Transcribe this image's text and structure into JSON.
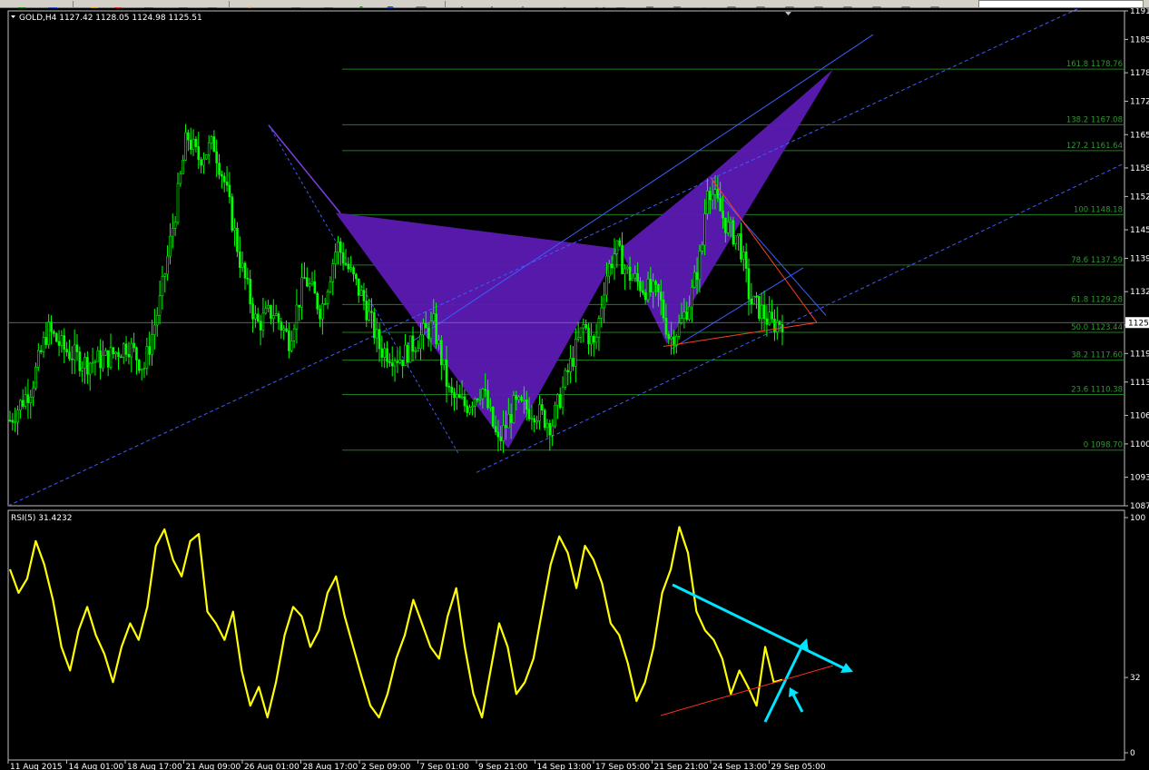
{
  "toolbar": {
    "buttons": [
      "new-order-icon",
      "open-icon",
      "zoom-in-icon",
      "zoom-out-icon",
      "tile-icon",
      "scroll-icon",
      "autoscroll-icon",
      "crosshair-icon",
      "line-icon",
      "indicator-icon",
      "period-icon",
      "template-icon"
    ]
  },
  "main_chart": {
    "title": "GOLD,H4  1127.42  1128.05  1124.98  1125.51",
    "current_price": "1125",
    "colors": {
      "background": "#000000",
      "candle": "#00ff00",
      "fib_line": "#1e7d1e",
      "fib_text": "#2e9a2e",
      "pattern_fill": "#5b1ab3",
      "channel": "#3d5cff",
      "triangle": "#ff4020"
    }
  },
  "rsi_panel": {
    "title": "RSI(5) 31.4232",
    "line_color": "#ffff00",
    "arrow_color": "#00e5ff"
  },
  "chart_data": [
    {
      "type": "candlestick",
      "symbol": "GOLD",
      "timeframe": "H4",
      "ylim": [
        1087,
        1191
      ],
      "y_ticks": [
        1191,
        1185,
        1178,
        1172,
        1165,
        1158,
        1152,
        1145,
        1139,
        1132,
        1125,
        1119,
        1113,
        1106,
        1100,
        1093,
        1087
      ],
      "fib_levels": [
        {
          "label": "161.8 1178.76",
          "value": 1178.76
        },
        {
          "label": "138.2 1167.08",
          "value": 1167.08
        },
        {
          "label": "127.2 1161.64",
          "value": 1161.64
        },
        {
          "label": "100 1148.18",
          "value": 1148.18
        },
        {
          "label": "78.6 1137.59",
          "value": 1137.59
        },
        {
          "label": "61.8 1129.28",
          "value": 1129.28
        },
        {
          "label": "50.0 1123.44",
          "value": 1123.44
        },
        {
          "label": "38.2 1117.60",
          "value": 1117.6
        },
        {
          "label": "23.6 1110.38",
          "value": 1110.38
        },
        {
          "label": "0 1098.70",
          "value": 1098.7
        }
      ],
      "close_path": [
        [
          0,
          1105
        ],
        [
          0.02,
          1112
        ],
        [
          0.035,
          1124
        ],
        [
          0.05,
          1120
        ],
        [
          0.07,
          1117
        ],
        [
          0.09,
          1118
        ],
        [
          0.11,
          1121
        ],
        [
          0.125,
          1116
        ],
        [
          0.14,
          1130
        ],
        [
          0.155,
          1150
        ],
        [
          0.165,
          1165
        ],
        [
          0.175,
          1160
        ],
        [
          0.19,
          1163
        ],
        [
          0.2,
          1155
        ],
        [
          0.215,
          1138
        ],
        [
          0.23,
          1125
        ],
        [
          0.245,
          1128
        ],
        [
          0.26,
          1122
        ],
        [
          0.275,
          1135
        ],
        [
          0.29,
          1128
        ],
        [
          0.305,
          1142
        ],
        [
          0.315,
          1137
        ],
        [
          0.33,
          1130
        ],
        [
          0.345,
          1120
        ],
        [
          0.365,
          1118
        ],
        [
          0.38,
          1122
        ],
        [
          0.395,
          1125
        ],
        [
          0.41,
          1110
        ],
        [
          0.425,
          1108
        ],
        [
          0.44,
          1112
        ],
        [
          0.455,
          1100
        ],
        [
          0.47,
          1108
        ],
        [
          0.49,
          1107
        ],
        [
          0.505,
          1104
        ],
        [
          0.52,
          1115
        ],
        [
          0.535,
          1125
        ],
        [
          0.545,
          1120
        ],
        [
          0.555,
          1135
        ],
        [
          0.565,
          1141
        ],
        [
          0.575,
          1136
        ],
        [
          0.59,
          1133
        ],
        [
          0.605,
          1131
        ],
        [
          0.615,
          1122
        ],
        [
          0.625,
          1125
        ],
        [
          0.635,
          1131
        ],
        [
          0.645,
          1141
        ],
        [
          0.65,
          1155
        ],
        [
          0.66,
          1150
        ],
        [
          0.67,
          1145
        ],
        [
          0.68,
          1143
        ],
        [
          0.69,
          1130
        ],
        [
          0.7,
          1128
        ],
        [
          0.71,
          1125
        ],
        [
          0.72,
          1126
        ]
      ]
    },
    {
      "type": "line",
      "name": "RSI(5)",
      "value": 31.4232,
      "ylim": [
        0,
        100
      ],
      "y_ticks": [
        100,
        32,
        0
      ],
      "x_tick_labels": [
        "11 Aug 2015",
        "14 Aug 01:00",
        "18 Aug 17:00",
        "21 Aug 09:00",
        "26 Aug 01:00",
        "28 Aug 17:00",
        "2 Sep 09:00",
        "7 Sep 01:00",
        "9 Sep 21:00",
        "14 Sep 13:00",
        "17 Sep 05:00",
        "21 Sep 21:00",
        "24 Sep 13:00",
        "29 Sep 05:00"
      ],
      "values": [
        78,
        68,
        74,
        90,
        80,
        65,
        45,
        35,
        52,
        62,
        50,
        42,
        30,
        45,
        55,
        48,
        62,
        88,
        95,
        82,
        75,
        90,
        93,
        60,
        55,
        48,
        60,
        35,
        20,
        28,
        15,
        30,
        50,
        62,
        58,
        45,
        52,
        68,
        75,
        58,
        45,
        32,
        20,
        15,
        25,
        40,
        50,
        65,
        55,
        45,
        40,
        58,
        70,
        45,
        25,
        15,
        35,
        55,
        45,
        25,
        30,
        40,
        60,
        80,
        92,
        85,
        70,
        88,
        82,
        72,
        55,
        50,
        38,
        22,
        30,
        45,
        68,
        78,
        96,
        85,
        60,
        52,
        48,
        40,
        25,
        35,
        28,
        20,
        45,
        30,
        31
      ]
    }
  ]
}
